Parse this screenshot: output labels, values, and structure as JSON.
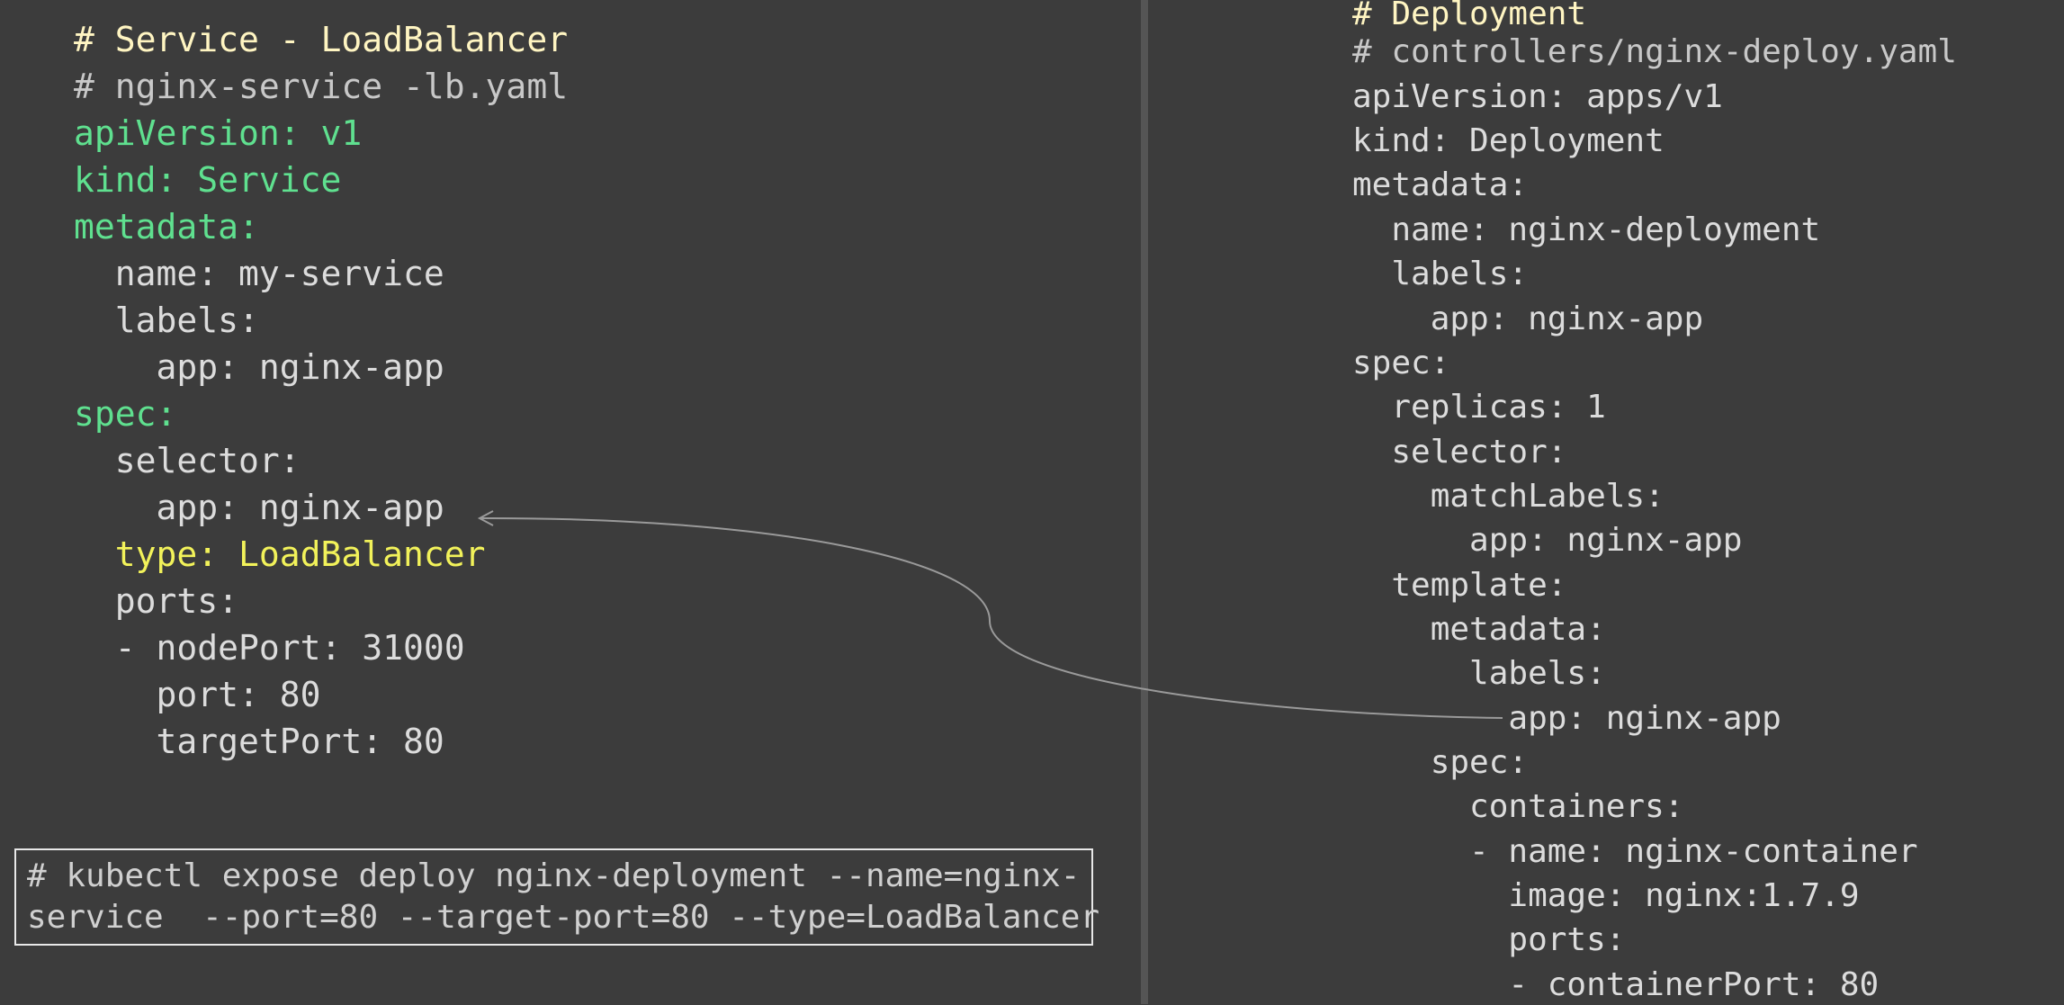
{
  "left": {
    "lines": [
      "# Service - LoadBalancer",
      "# nginx-service -lb.yaml",
      "apiVersion: v1",
      "kind: Service",
      "metadata:",
      "  name: my-service",
      "  labels:",
      "    app: nginx-app",
      "spec:",
      "  selector:",
      "    app: nginx-app",
      "  type: LoadBalancer",
      "  ports:",
      "  - nodePort: 31000",
      "    port: 80",
      "    targetPort: 80"
    ]
  },
  "command": {
    "line1": "# kubectl expose deploy nginx-deployment --name=nginx-",
    "line2": "service  --port=80 --target-port=80 --type=LoadBalancer"
  },
  "right": {
    "lines": [
      "# Deployment",
      "# controllers/nginx-deploy.yaml",
      "apiVersion: apps/v1",
      "kind: Deployment",
      "metadata:",
      "  name: nginx-deployment",
      "  labels:",
      "    app: nginx-app",
      "spec:",
      "  replicas: 1",
      "  selector:",
      "    matchLabels:",
      "      app: nginx-app",
      "  template:",
      "    metadata:",
      "      labels:",
      "        app: nginx-app",
      "    spec:",
      "      containers:",
      "      - name: nginx-container",
      "        image: nginx:1.7.9",
      "        ports:",
      "        - containerPort: 80"
    ]
  },
  "colors": {
    "background": "#3c3c3c",
    "heading": "#fff5c2",
    "key_green": "#5fe08f",
    "value_yellow": "#f2f25a",
    "text": "#dcdcdc",
    "divider": "#555555",
    "connector": "#9a9a9a"
  }
}
